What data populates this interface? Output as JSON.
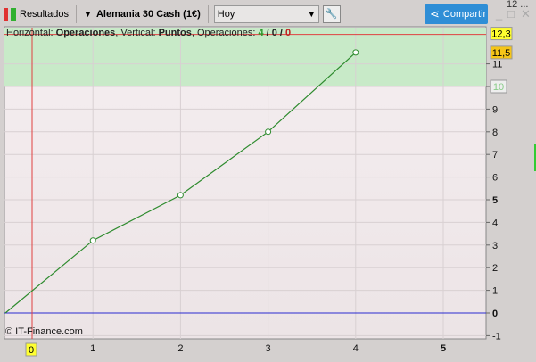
{
  "toolbar": {
    "results_label": "Resultados",
    "instrument": "Alemania 30 Cash (1€)",
    "period": "Hoy",
    "share_label": "Compartir",
    "top_right_partial": "12 ..."
  },
  "info": {
    "h_label": "Horizontal: ",
    "h_value": "Operaciones",
    "v_label": ", Vertical: ",
    "v_value": "Puntos",
    "ops_label": ", Operaciones: ",
    "ops_win": "4",
    "ops_mid": "0",
    "ops_loss": "0"
  },
  "copyright": "© IT-Finance.com",
  "colors": {
    "line": "#2e8b2e",
    "zone": "#c8eac8",
    "cursor": "#e04040",
    "zero": "#2a2ad0",
    "share": "#2f8ed6"
  },
  "chart_data": {
    "type": "line",
    "x": [
      0,
      1,
      2,
      3,
      4
    ],
    "y": [
      0,
      3.2,
      5.2,
      8,
      11.5
    ],
    "xlim": [
      0,
      5.5
    ],
    "ylim": [
      -1.2,
      12.5
    ],
    "xticks": [
      "1",
      "2",
      "3",
      "4",
      "5"
    ],
    "yticks": [
      "-1",
      "0",
      "1",
      "2",
      "3",
      "4",
      "5",
      "6",
      "7",
      "8",
      "9",
      "10",
      "11"
    ],
    "cursor_x_label": "0",
    "cursor_y_label": "12,3",
    "last_value_label": "11,5",
    "zone_label": "10"
  }
}
